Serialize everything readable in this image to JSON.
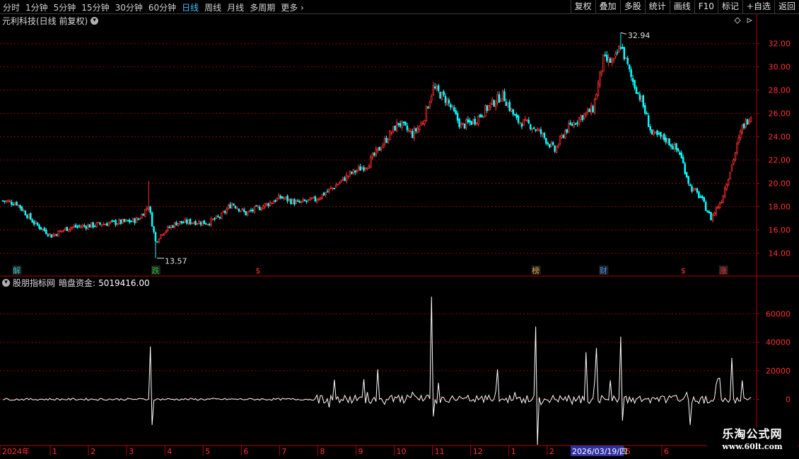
{
  "toolbar": {
    "periods": [
      "分时",
      "1分钟",
      "5分钟",
      "15分钟",
      "30分钟",
      "60分钟",
      "日线",
      "周线",
      "月线",
      "多周期",
      "更多"
    ],
    "active_period": "日线",
    "buttons": [
      "复权",
      "叠加",
      "多股",
      "统计",
      "画线",
      "F10",
      "标记",
      "+自选",
      "返回"
    ]
  },
  "main_panel": {
    "title": "元利科技(日线 前复权)",
    "high_label": "32.94",
    "low_label": "13.57"
  },
  "indicator_panel": {
    "source": "股朋指标网",
    "indicator": "暗盘资金:",
    "value": "5019416.00"
  },
  "event_markers": [
    {
      "text": "解",
      "color": "#30c0c0"
    },
    {
      "text": "跌",
      "color": "#20c020"
    },
    {
      "text": "$",
      "color": "#ff3030"
    },
    {
      "text": "榜",
      "color": "#e0a040"
    },
    {
      "text": "财",
      "color": "#4090ff"
    },
    {
      "text": "$",
      "color": "#ff3030"
    },
    {
      "text": "涨",
      "color": "#ff3030"
    }
  ],
  "time_axis": {
    "labels": [
      "2024年",
      "1",
      "2",
      "3",
      "4",
      "5",
      "6",
      "7",
      "8",
      "9",
      "10",
      "11",
      "12",
      "1",
      "2",
      "3",
      "5",
      "6"
    ],
    "cursor_date": "2026/03/19/四"
  },
  "watermark": {
    "title": "乐淘公式网",
    "url": "www.60lt.com"
  },
  "colors": {
    "up": "#ff3030",
    "down": "#00ffff",
    "grid": "#8b0000",
    "frame": "#b00000",
    "indicator_line": "#ffffff"
  },
  "chart_data": [
    {
      "type": "candlestick",
      "title": "元利科技(日线 前复权)",
      "ylim": [
        13,
        33.5
      ],
      "yticks": [
        14.0,
        16.0,
        18.0,
        20.0,
        22.0,
        24.0,
        26.0,
        28.0,
        30.0,
        32.0
      ],
      "high": 32.94,
      "low": 13.57,
      "close_path": [
        {
          "i": 0,
          "v": 18.5
        },
        {
          "i": 8,
          "v": 18.3
        },
        {
          "i": 18,
          "v": 16.6
        },
        {
          "i": 28,
          "v": 15.5
        },
        {
          "i": 38,
          "v": 16.2
        },
        {
          "i": 52,
          "v": 16.4
        },
        {
          "i": 62,
          "v": 16.6
        },
        {
          "i": 72,
          "v": 16.7
        },
        {
          "i": 78,
          "v": 16.9
        },
        {
          "i": 84,
          "v": 18.1
        },
        {
          "i": 88,
          "v": 15.0
        },
        {
          "i": 92,
          "v": 15.8
        },
        {
          "i": 100,
          "v": 16.6
        },
        {
          "i": 110,
          "v": 16.7
        },
        {
          "i": 118,
          "v": 16.6
        },
        {
          "i": 126,
          "v": 17.2
        },
        {
          "i": 132,
          "v": 18.3
        },
        {
          "i": 140,
          "v": 17.4
        },
        {
          "i": 152,
          "v": 18.2
        },
        {
          "i": 160,
          "v": 18.8
        },
        {
          "i": 170,
          "v": 18.3
        },
        {
          "i": 180,
          "v": 18.6
        },
        {
          "i": 190,
          "v": 19.6
        },
        {
          "i": 200,
          "v": 20.8
        },
        {
          "i": 210,
          "v": 21.6
        },
        {
          "i": 218,
          "v": 23.2
        },
        {
          "i": 228,
          "v": 25.2
        },
        {
          "i": 236,
          "v": 24.2
        },
        {
          "i": 242,
          "v": 25.3
        },
        {
          "i": 248,
          "v": 28.2
        },
        {
          "i": 256,
          "v": 27.1
        },
        {
          "i": 264,
          "v": 24.9
        },
        {
          "i": 272,
          "v": 25.4
        },
        {
          "i": 280,
          "v": 26.6
        },
        {
          "i": 288,
          "v": 27.6
        },
        {
          "i": 296,
          "v": 25.4
        },
        {
          "i": 304,
          "v": 25.0
        },
        {
          "i": 310,
          "v": 24.3
        },
        {
          "i": 318,
          "v": 22.8
        },
        {
          "i": 324,
          "v": 24.5
        },
        {
          "i": 332,
          "v": 25.6
        },
        {
          "i": 340,
          "v": 26.4
        },
        {
          "i": 346,
          "v": 30.6
        },
        {
          "i": 352,
          "v": 30.4
        },
        {
          "i": 356,
          "v": 31.9
        },
        {
          "i": 362,
          "v": 29.1
        },
        {
          "i": 368,
          "v": 27.1
        },
        {
          "i": 374,
          "v": 24.2
        },
        {
          "i": 382,
          "v": 23.8
        },
        {
          "i": 390,
          "v": 22.6
        },
        {
          "i": 396,
          "v": 19.7
        },
        {
          "i": 402,
          "v": 18.8
        },
        {
          "i": 408,
          "v": 17.0
        },
        {
          "i": 414,
          "v": 18.6
        },
        {
          "i": 420,
          "v": 21.6
        },
        {
          "i": 426,
          "v": 24.8
        },
        {
          "i": 431,
          "v": 25.9
        }
      ],
      "bar_count": 432
    },
    {
      "type": "line",
      "name": "暗盘资金",
      "ylim": [
        -32000,
        78000
      ],
      "yticks": [
        0,
        20000,
        40000,
        60000
      ],
      "baseline": 0,
      "spikes": [
        {
          "i": 85,
          "v": 37000
        },
        {
          "i": 86,
          "v": -18000
        },
        {
          "i": 208,
          "v": 14000
        },
        {
          "i": 216,
          "v": 21000
        },
        {
          "i": 247,
          "v": 72000
        },
        {
          "i": 248,
          "v": -12000
        },
        {
          "i": 285,
          "v": 21000
        },
        {
          "i": 307,
          "v": 51000
        },
        {
          "i": 308,
          "v": -32000
        },
        {
          "i": 336,
          "v": 33000
        },
        {
          "i": 342,
          "v": 36000
        },
        {
          "i": 356,
          "v": 44000
        },
        {
          "i": 357,
          "v": -15000
        },
        {
          "i": 396,
          "v": -18000
        },
        {
          "i": 420,
          "v": 29000
        }
      ],
      "bar_count": 432
    }
  ]
}
